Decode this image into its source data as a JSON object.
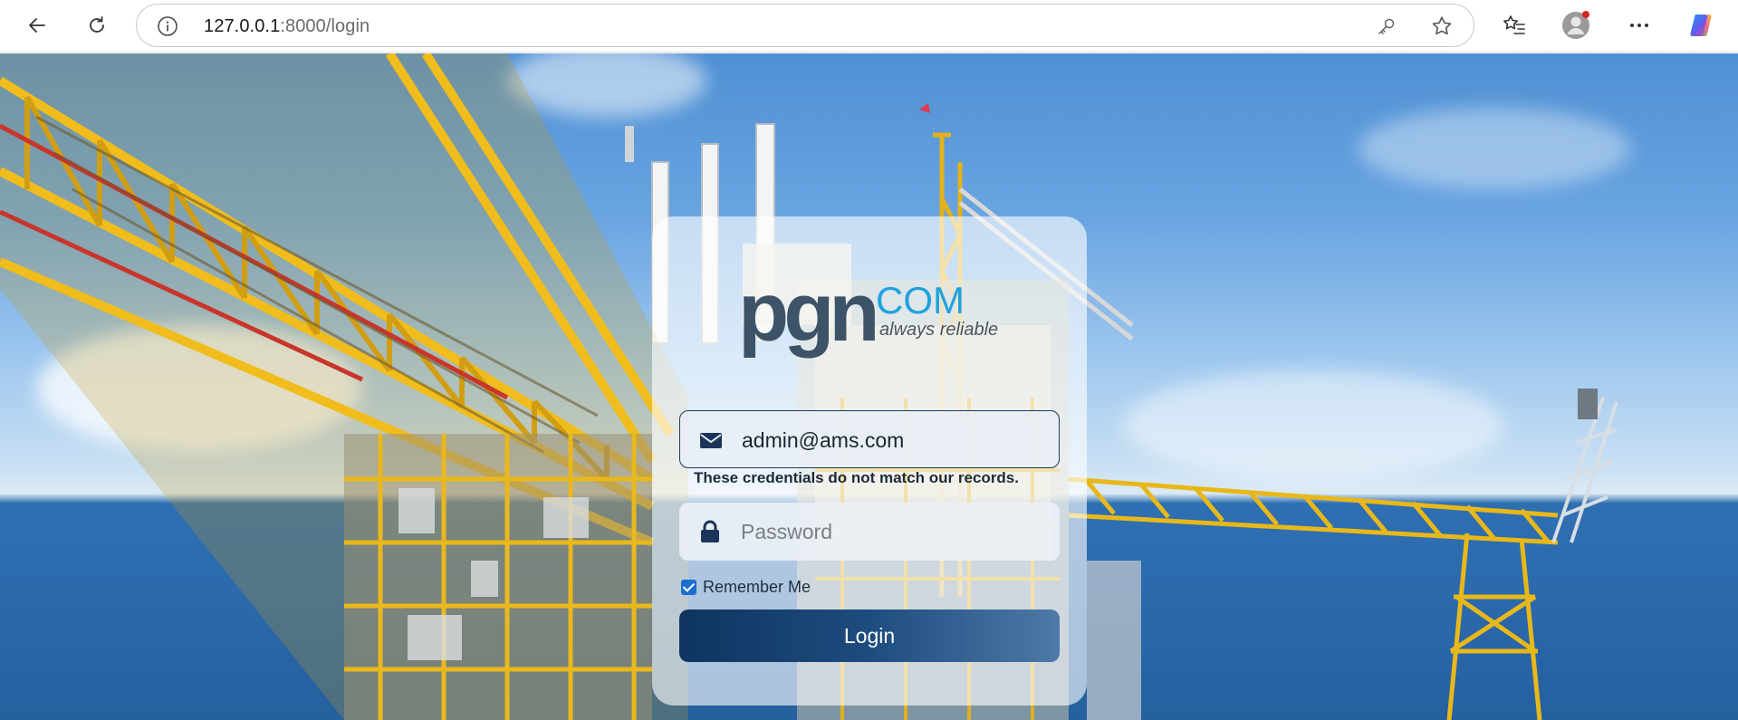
{
  "browser": {
    "url_host": "127.0.0.1",
    "url_rest": ":8000/login"
  },
  "logo": {
    "brand": "pgn",
    "suffix": "COM",
    "tagline": "always reliable"
  },
  "form": {
    "email_value": "admin@ams.com",
    "error_message": "These credentials do not match our records.",
    "password_placeholder": "Password",
    "remember_label": "Remember Me",
    "remember_checked": true,
    "login_label": "Login"
  },
  "colors": {
    "button_start": "#0f3460",
    "button_end": "#4d7aa8",
    "logo_text": "#3d5468",
    "logo_accent": "#1fa2de",
    "checkbox": "#1a6fd0"
  }
}
